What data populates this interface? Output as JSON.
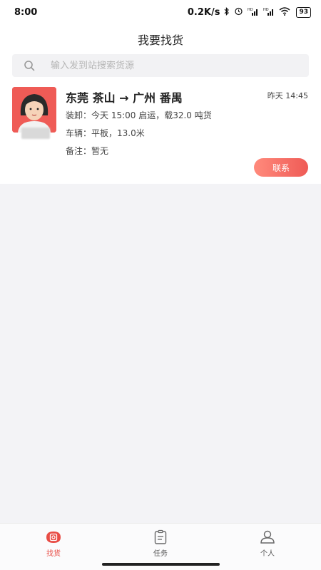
{
  "status_bar": {
    "time": "8:00",
    "speed": "0.2K/s",
    "bluetooth_icon": "bluetooth-icon",
    "alarm_icon": "alarm-icon",
    "signal1": "HD",
    "signal2": "HD",
    "wifi_icon": "wifi-icon",
    "battery": "93"
  },
  "header": {
    "title": "我要找货"
  },
  "search": {
    "placeholder": "输入发到站搜索货源",
    "icon": "search-icon"
  },
  "listing": {
    "route": "东莞 茶山 → 广州 番禺",
    "time": "昨天 14:45",
    "loading": "装卸：今天 15:00 启运，载32.0 吨货",
    "vehicle": "车辆：平板，13.0米",
    "remark": "备注：暂无",
    "contact_label": "联系"
  },
  "tabbar": {
    "items": [
      {
        "label": "找货",
        "icon": "find-goods-icon",
        "active": true
      },
      {
        "label": "任务",
        "icon": "task-icon",
        "active": false
      },
      {
        "label": "个人",
        "icon": "profile-icon",
        "active": false
      }
    ]
  },
  "colors": {
    "accent": "#ef5b56",
    "background": "#f3f3f6"
  }
}
